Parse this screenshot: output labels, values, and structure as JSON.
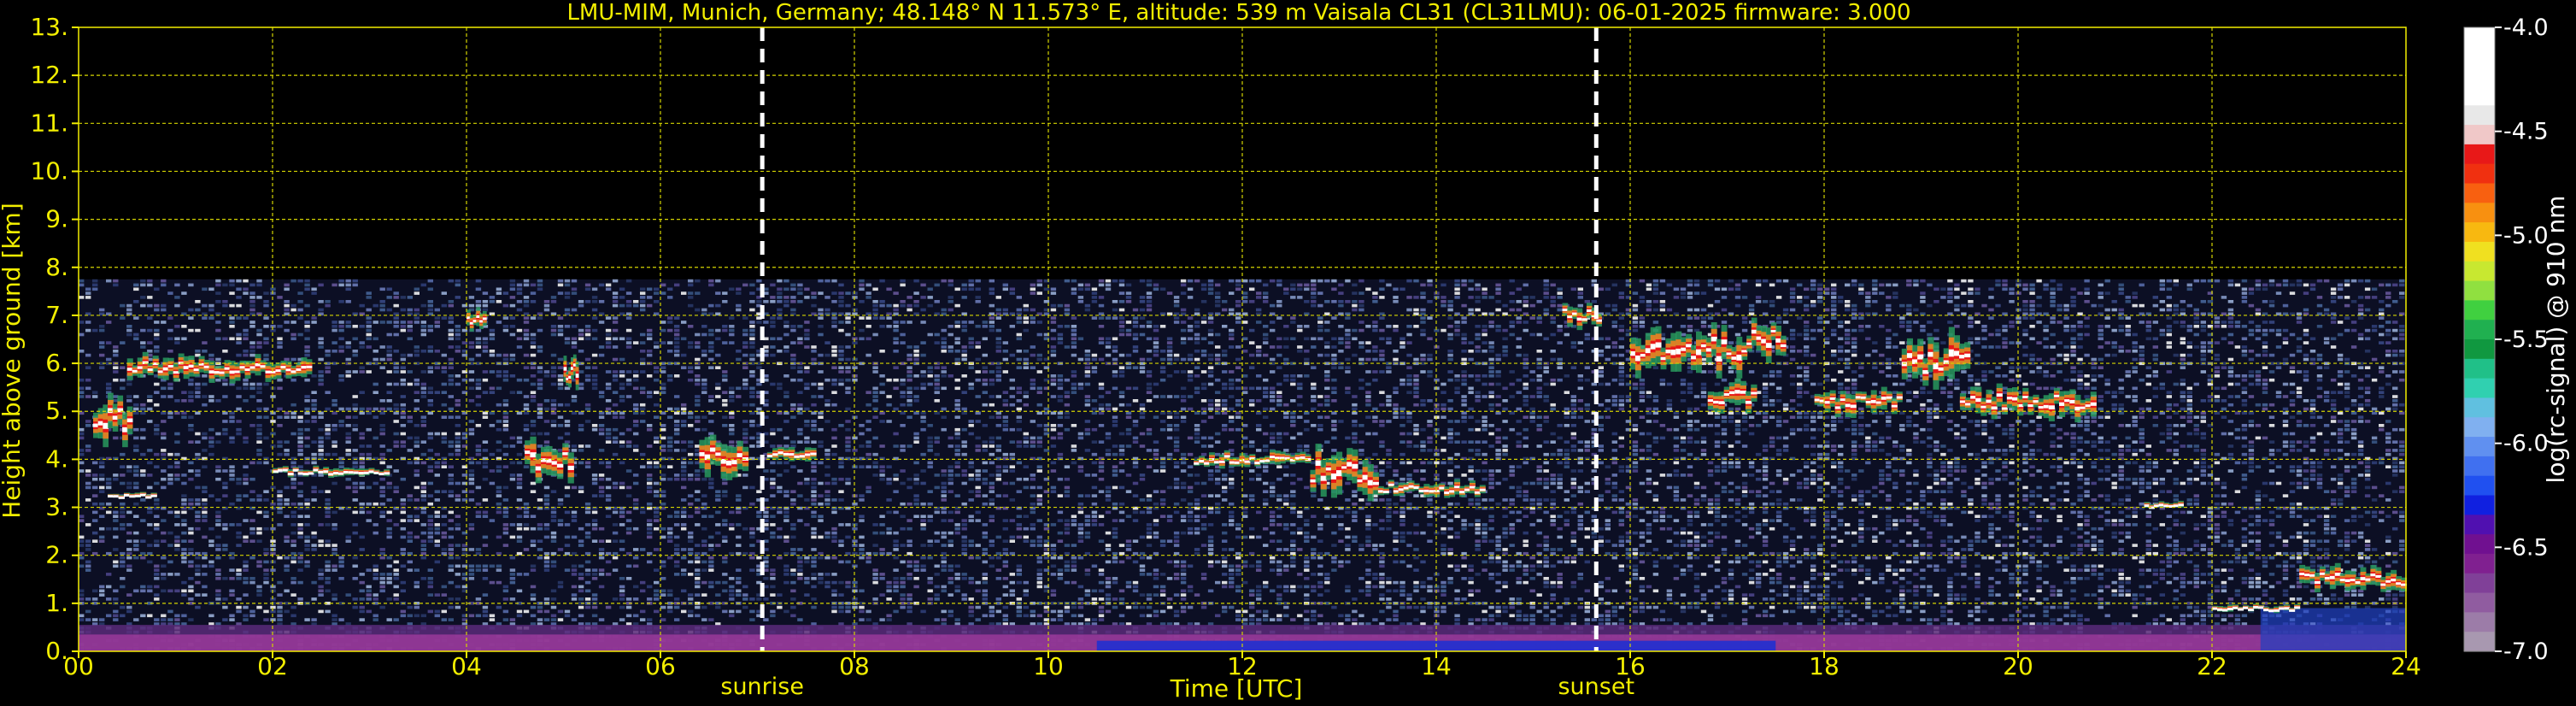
{
  "chart_data": {
    "type": "heatmap",
    "title": "LMU-MIM, Munich, Germany; 48.148° N 11.573° E, altitude: 539 m    Vaisala CL31 (CL31LMU): 06-01-2025    firmware: 3.000",
    "xlabel": "Time [UTC]",
    "ylabel": "Height above ground [km]",
    "xlim": [
      0,
      24
    ],
    "ylim": [
      0,
      13
    ],
    "x_ticks": [
      "00",
      "02",
      "04",
      "06",
      "08",
      "10",
      "12",
      "14",
      "16",
      "18",
      "20",
      "22",
      "24"
    ],
    "y_ticks": [
      "0.",
      "1.",
      "2.",
      "3.",
      "4.",
      "5.",
      "6.",
      "7.",
      "8.",
      "9.",
      "10.",
      "11.",
      "12.",
      "13."
    ],
    "grid": true,
    "grid_color": "#d4d400",
    "text_color": "#f2ee00",
    "annotations": [
      {
        "label": "sunrise",
        "x": 7.05
      },
      {
        "label": "sunset",
        "x": 15.65
      }
    ],
    "colorbar": {
      "label": "log(rc-signal) @ 910 nm",
      "range": [
        -7.0,
        -4.0
      ],
      "ticks": [
        "-4.0",
        "-4.5",
        "-5.0",
        "-5.5",
        "-6.0",
        "-6.5",
        "-7.0"
      ],
      "colors": [
        "#ffffff",
        "#ffffff",
        "#ffffff",
        "#ffffff",
        "#e8e8e8",
        "#f0c8c8",
        "#e81818",
        "#f03010",
        "#f86010",
        "#f89010",
        "#f8b810",
        "#f0e020",
        "#c8e830",
        "#90e040",
        "#40d040",
        "#20b050",
        "#109840",
        "#20c088",
        "#30d0b0",
        "#60c0e0",
        "#80b0f0",
        "#6090f0",
        "#4070f0",
        "#2050f0",
        "#1020e0",
        "#5010b0",
        "#701090",
        "#802090",
        "#804098",
        "#905ca0",
        "#9c7ca8",
        "#a898b0"
      ]
    },
    "cloud_layers": [
      {
        "t0": 0.15,
        "t1": 0.55,
        "h": 4.8,
        "thick": 0.9
      },
      {
        "t0": 0.5,
        "t1": 2.4,
        "h": 5.9,
        "thick": 0.5
      },
      {
        "t0": 0.3,
        "t1": 0.8,
        "h": 3.25,
        "thick": 0.12
      },
      {
        "t0": 2.0,
        "t1": 3.2,
        "h": 3.75,
        "thick": 0.2
      },
      {
        "t0": 4.0,
        "t1": 4.2,
        "h": 6.9,
        "thick": 0.4
      },
      {
        "t0": 4.6,
        "t1": 5.1,
        "h": 4.0,
        "thick": 0.8
      },
      {
        "t0": 5.0,
        "t1": 5.15,
        "h": 5.8,
        "thick": 0.7
      },
      {
        "t0": 6.4,
        "t1": 6.9,
        "h": 4.0,
        "thick": 0.9
      },
      {
        "t0": 7.1,
        "t1": 7.6,
        "h": 4.1,
        "thick": 0.3
      },
      {
        "t0": 11.5,
        "t1": 12.7,
        "h": 4.0,
        "thick": 0.3
      },
      {
        "t0": 12.7,
        "t1": 13.4,
        "h": 3.7,
        "thick": 0.9
      },
      {
        "t0": 13.4,
        "t1": 14.5,
        "h": 3.4,
        "thick": 0.35
      },
      {
        "t0": 15.3,
        "t1": 15.7,
        "h": 7.0,
        "thick": 0.5
      },
      {
        "t0": 16.0,
        "t1": 17.2,
        "h": 6.3,
        "thick": 0.9
      },
      {
        "t0": 16.8,
        "t1": 17.3,
        "h": 5.3,
        "thick": 0.6
      },
      {
        "t0": 17.2,
        "t1": 17.6,
        "h": 6.5,
        "thick": 0.8
      },
      {
        "t0": 17.9,
        "t1": 18.8,
        "h": 5.2,
        "thick": 0.5
      },
      {
        "t0": 18.8,
        "t1": 19.5,
        "h": 6.0,
        "thick": 1.1
      },
      {
        "t0": 19.4,
        "t1": 20.8,
        "h": 5.2,
        "thick": 0.6
      },
      {
        "t0": 21.3,
        "t1": 21.7,
        "h": 3.05,
        "thick": 0.15
      },
      {
        "t0": 22.0,
        "t1": 22.9,
        "h": 0.9,
        "thick": 0.15
      },
      {
        "t0": 22.9,
        "t1": 24.0,
        "h": 1.5,
        "thick": 0.5
      }
    ]
  }
}
